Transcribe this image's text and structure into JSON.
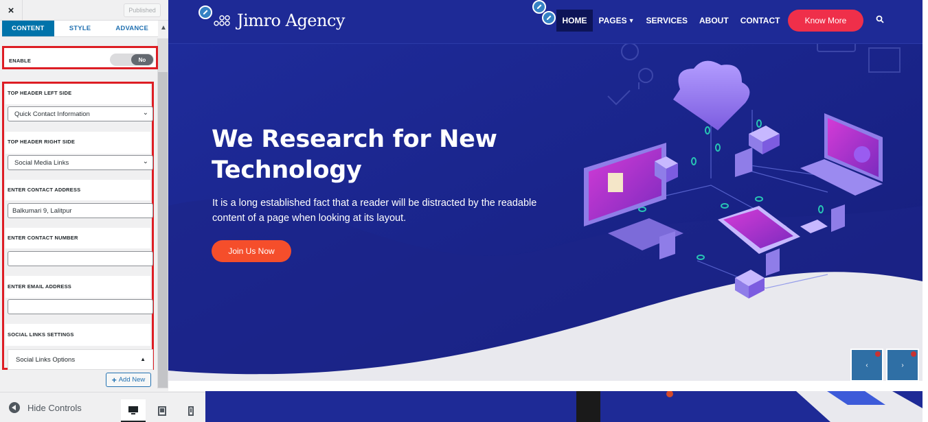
{
  "sidebar": {
    "close_label": "×",
    "published_label": "Published",
    "tabs": [
      {
        "label": "CONTENT",
        "active": true
      },
      {
        "label": "STYLE",
        "active": false
      },
      {
        "label": "ADVANCE",
        "active": false
      }
    ],
    "enable": {
      "label": "ENABLE",
      "value": "No"
    },
    "fields": {
      "left_side_label": "TOP HEADER LEFT SIDE",
      "left_side_value": "Quick Contact Information",
      "right_side_label": "TOP HEADER RIGHT SIDE",
      "right_side_value": "Social Media Links",
      "address_label": "ENTER CONTACT ADDRESS",
      "address_value": "Balkumari 9, Lalitpur",
      "number_label": "ENTER CONTACT NUMBER",
      "number_value": "",
      "email_label": "ENTER EMAIL ADDRESS",
      "email_value": "",
      "social_label": "SOCIAL LINKS SETTINGS",
      "social_options": "Social Links Options"
    },
    "add_new_label": "Add New",
    "hide_controls_label": "Hide Controls"
  },
  "preview": {
    "logo_text": "Jimro Agency",
    "nav": [
      {
        "label": "HOME",
        "active": true
      },
      {
        "label": "PAGES",
        "dropdown": true
      },
      {
        "label": "SERVICES"
      },
      {
        "label": "ABOUT"
      },
      {
        "label": "CONTACT"
      }
    ],
    "cta_label": "Know More",
    "hero_title": "We Research for New Technology",
    "hero_text": "It is a long established fact that a reader will be distracted by the readable content of a page when looking at its layout.",
    "join_label": "Join Us Now"
  },
  "colors": {
    "wp_blue": "#0073aa",
    "highlight_red": "#dd1d24",
    "hero_bg": "#1a237e",
    "cta_red": "#ef2f4a",
    "join_orange": "#f54e2b"
  }
}
